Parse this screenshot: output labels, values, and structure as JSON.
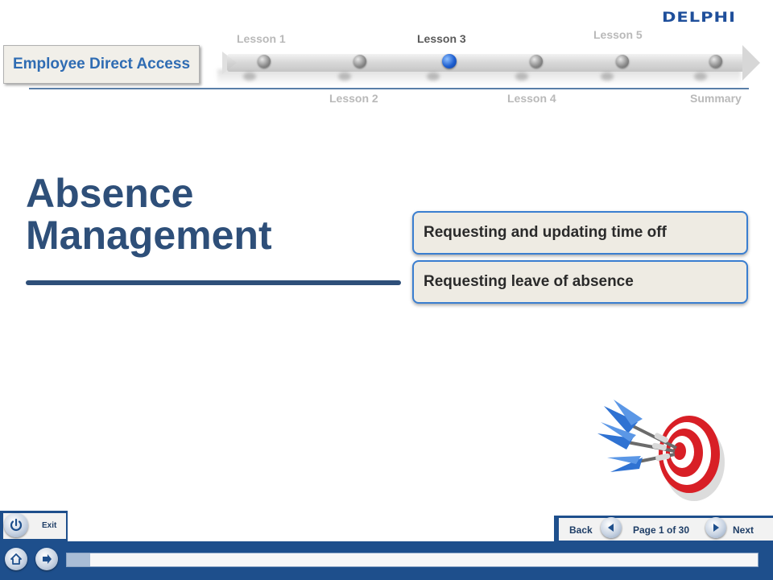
{
  "brand": {
    "logo_text": "DELPHI"
  },
  "course": {
    "title": "Employee Direct Access"
  },
  "timeline": {
    "labels": {
      "lesson1": "Lesson 1",
      "lesson2": "Lesson 2",
      "lesson3": "Lesson 3",
      "lesson4": "Lesson 4",
      "lesson5": "Lesson 5",
      "summary": "Summary"
    },
    "current": "Lesson 3"
  },
  "main": {
    "title": "Absence Management",
    "topics": [
      {
        "label": "Requesting and updating time off"
      },
      {
        "label": "Requesting leave of absence"
      }
    ]
  },
  "footer": {
    "exit_label": "Exit",
    "back_label": "Back",
    "next_label": "Next",
    "page_counter": "Page 1 of 30",
    "progress_fraction": 0.0333
  },
  "colors": {
    "primary_blue": "#1e4f8c",
    "title_navy": "#2e4f79",
    "accent_blue": "#3a7ed0",
    "active_node": "#1e5fd0",
    "logo_blue": "#1f4f9b"
  },
  "icons": {
    "exit": "power-icon",
    "home": "home-icon",
    "forward": "forward-arrow-icon",
    "back": "left-arrow-icon",
    "next": "right-arrow-icon",
    "illustration": "dartboard-icon"
  }
}
